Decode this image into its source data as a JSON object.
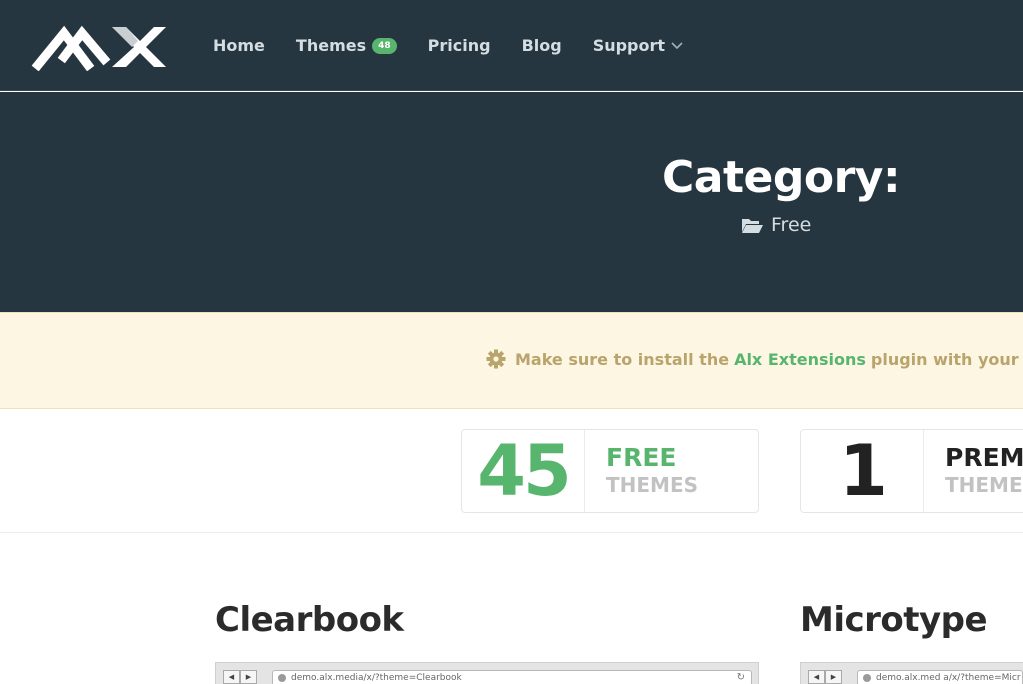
{
  "header": {
    "logo_alt": "AlX",
    "nav": [
      {
        "label": "Home"
      },
      {
        "label": "Themes",
        "badge": "48"
      },
      {
        "label": "Pricing"
      },
      {
        "label": "Blog"
      },
      {
        "label": "Support",
        "icon": "chevron-down-icon"
      }
    ]
  },
  "hero": {
    "title": "Category:",
    "subtitle": "Free",
    "subtitle_icon": "folder-open-icon"
  },
  "notice": {
    "icon": "gear-icon",
    "text_before": "Make sure to install the",
    "link": "Alx Extensions",
    "text_after": "plugin with your th"
  },
  "stats": [
    {
      "number": "45",
      "label1": "FREE",
      "label2": "THEMES"
    },
    {
      "number": "1",
      "label1": "PREM",
      "label2": "THEMES"
    }
  ],
  "themes": [
    {
      "title": "Clearbook",
      "url": "demo.alx.media/x/?theme=Clearbook"
    },
    {
      "title": "Microtype",
      "url": "demo.alx.med a/x/?theme=Micr"
    }
  ],
  "colors": {
    "header_bg": "#263640",
    "accent_green": "#58b56e",
    "notice_bg": "#fdf6e3",
    "notice_text": "#b8a46c"
  }
}
